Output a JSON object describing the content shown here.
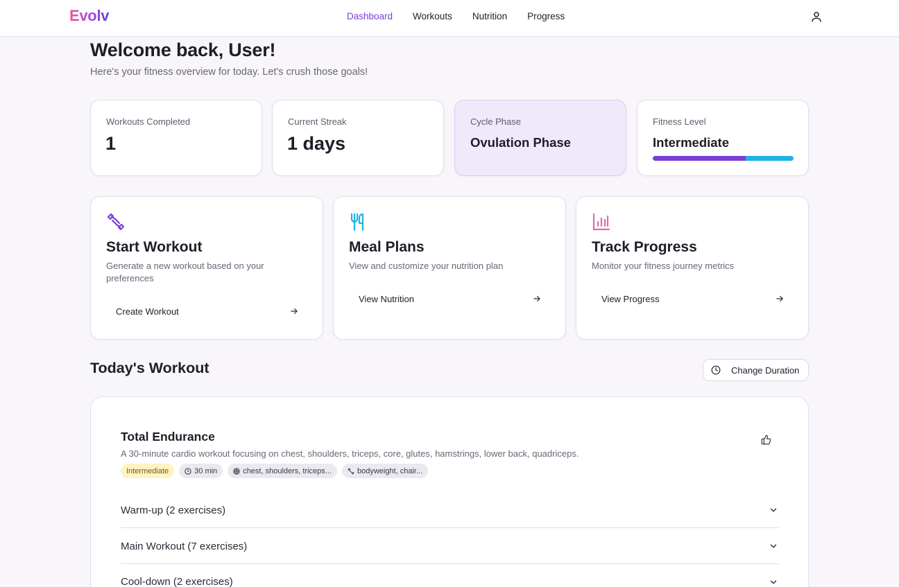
{
  "app": {
    "logo": "Evolv"
  },
  "nav": {
    "items": [
      {
        "label": "Dashboard",
        "active": true
      },
      {
        "label": "Workouts",
        "active": false
      },
      {
        "label": "Nutrition",
        "active": false
      },
      {
        "label": "Progress",
        "active": false
      }
    ],
    "user_icon": "user-icon"
  },
  "header": {
    "title": "Welcome back, User!",
    "subtitle": "Here's your fitness overview for today. Let's crush those goals!"
  },
  "stats": {
    "workouts": {
      "label": "Workouts Completed",
      "value": "1"
    },
    "streak": {
      "label": "Current Streak",
      "value": "1 days"
    },
    "cycle": {
      "label": "Cycle Phase",
      "value": "Ovulation Phase"
    },
    "fitness": {
      "label": "Fitness Level",
      "value": "Intermediate",
      "progress": 0.66
    }
  },
  "actions": {
    "workout": {
      "icon": "dumbbell-icon",
      "title": "Start Workout",
      "desc": "Generate a new workout based on your preferences",
      "link": "Create Workout"
    },
    "meals": {
      "icon": "utensils-icon",
      "title": "Meal Plans",
      "desc": "View and customize your nutrition plan",
      "link": "View Nutrition"
    },
    "progress": {
      "icon": "bar-chart-icon",
      "title": "Track Progress",
      "desc": "Monitor your fitness journey metrics",
      "link": "View Progress"
    }
  },
  "today": {
    "title": "Today's Workout",
    "duration_button": "Change Duration",
    "workout": {
      "title": "Total Endurance",
      "desc": "A 30-minute cardio workout focusing on chest, shoulders, triceps, core, glutes, hamstrings, lower back, quadriceps.",
      "tags": {
        "level": "Intermediate",
        "duration": "30 min",
        "muscles": "chest, shoulders, triceps...",
        "equipment": "bodyweight, chair..."
      },
      "sections": [
        "Warm-up (2 exercises)",
        "Main Workout (7 exercises)",
        "Cool-down (2 exercises)"
      ]
    }
  },
  "colors": {
    "accent": "#7b3fd6",
    "secondary": "#1fb0e6",
    "pink": "#e26aa8",
    "cycle_card_bg": "#efe9fa",
    "tag_level_bg": "#fdf3c3"
  }
}
